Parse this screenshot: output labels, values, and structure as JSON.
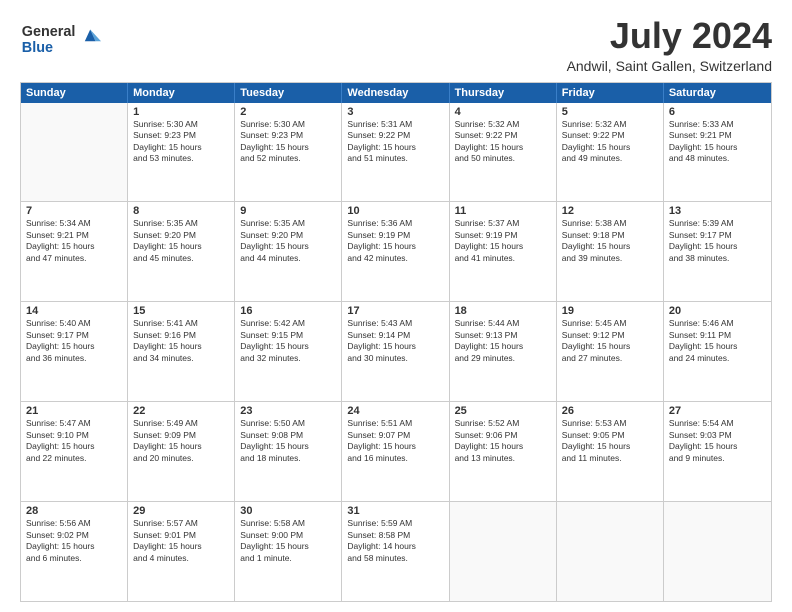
{
  "header": {
    "title": "July 2024",
    "subtitle": "Andwil, Saint Gallen, Switzerland",
    "logo_general": "General",
    "logo_blue": "Blue"
  },
  "calendar": {
    "days": [
      "Sunday",
      "Monday",
      "Tuesday",
      "Wednesday",
      "Thursday",
      "Friday",
      "Saturday"
    ],
    "rows": [
      [
        {
          "day": "",
          "empty": true,
          "lines": []
        },
        {
          "day": "1",
          "empty": false,
          "lines": [
            "Sunrise: 5:30 AM",
            "Sunset: 9:23 PM",
            "Daylight: 15 hours",
            "and 53 minutes."
          ]
        },
        {
          "day": "2",
          "empty": false,
          "lines": [
            "Sunrise: 5:30 AM",
            "Sunset: 9:23 PM",
            "Daylight: 15 hours",
            "and 52 minutes."
          ]
        },
        {
          "day": "3",
          "empty": false,
          "lines": [
            "Sunrise: 5:31 AM",
            "Sunset: 9:22 PM",
            "Daylight: 15 hours",
            "and 51 minutes."
          ]
        },
        {
          "day": "4",
          "empty": false,
          "lines": [
            "Sunrise: 5:32 AM",
            "Sunset: 9:22 PM",
            "Daylight: 15 hours",
            "and 50 minutes."
          ]
        },
        {
          "day": "5",
          "empty": false,
          "lines": [
            "Sunrise: 5:32 AM",
            "Sunset: 9:22 PM",
            "Daylight: 15 hours",
            "and 49 minutes."
          ]
        },
        {
          "day": "6",
          "empty": false,
          "lines": [
            "Sunrise: 5:33 AM",
            "Sunset: 9:21 PM",
            "Daylight: 15 hours",
            "and 48 minutes."
          ]
        }
      ],
      [
        {
          "day": "7",
          "empty": false,
          "lines": [
            "Sunrise: 5:34 AM",
            "Sunset: 9:21 PM",
            "Daylight: 15 hours",
            "and 47 minutes."
          ]
        },
        {
          "day": "8",
          "empty": false,
          "lines": [
            "Sunrise: 5:35 AM",
            "Sunset: 9:20 PM",
            "Daylight: 15 hours",
            "and 45 minutes."
          ]
        },
        {
          "day": "9",
          "empty": false,
          "lines": [
            "Sunrise: 5:35 AM",
            "Sunset: 9:20 PM",
            "Daylight: 15 hours",
            "and 44 minutes."
          ]
        },
        {
          "day": "10",
          "empty": false,
          "lines": [
            "Sunrise: 5:36 AM",
            "Sunset: 9:19 PM",
            "Daylight: 15 hours",
            "and 42 minutes."
          ]
        },
        {
          "day": "11",
          "empty": false,
          "lines": [
            "Sunrise: 5:37 AM",
            "Sunset: 9:19 PM",
            "Daylight: 15 hours",
            "and 41 minutes."
          ]
        },
        {
          "day": "12",
          "empty": false,
          "lines": [
            "Sunrise: 5:38 AM",
            "Sunset: 9:18 PM",
            "Daylight: 15 hours",
            "and 39 minutes."
          ]
        },
        {
          "day": "13",
          "empty": false,
          "lines": [
            "Sunrise: 5:39 AM",
            "Sunset: 9:17 PM",
            "Daylight: 15 hours",
            "and 38 minutes."
          ]
        }
      ],
      [
        {
          "day": "14",
          "empty": false,
          "lines": [
            "Sunrise: 5:40 AM",
            "Sunset: 9:17 PM",
            "Daylight: 15 hours",
            "and 36 minutes."
          ]
        },
        {
          "day": "15",
          "empty": false,
          "lines": [
            "Sunrise: 5:41 AM",
            "Sunset: 9:16 PM",
            "Daylight: 15 hours",
            "and 34 minutes."
          ]
        },
        {
          "day": "16",
          "empty": false,
          "lines": [
            "Sunrise: 5:42 AM",
            "Sunset: 9:15 PM",
            "Daylight: 15 hours",
            "and 32 minutes."
          ]
        },
        {
          "day": "17",
          "empty": false,
          "lines": [
            "Sunrise: 5:43 AM",
            "Sunset: 9:14 PM",
            "Daylight: 15 hours",
            "and 30 minutes."
          ]
        },
        {
          "day": "18",
          "empty": false,
          "lines": [
            "Sunrise: 5:44 AM",
            "Sunset: 9:13 PM",
            "Daylight: 15 hours",
            "and 29 minutes."
          ]
        },
        {
          "day": "19",
          "empty": false,
          "lines": [
            "Sunrise: 5:45 AM",
            "Sunset: 9:12 PM",
            "Daylight: 15 hours",
            "and 27 minutes."
          ]
        },
        {
          "day": "20",
          "empty": false,
          "lines": [
            "Sunrise: 5:46 AM",
            "Sunset: 9:11 PM",
            "Daylight: 15 hours",
            "and 24 minutes."
          ]
        }
      ],
      [
        {
          "day": "21",
          "empty": false,
          "lines": [
            "Sunrise: 5:47 AM",
            "Sunset: 9:10 PM",
            "Daylight: 15 hours",
            "and 22 minutes."
          ]
        },
        {
          "day": "22",
          "empty": false,
          "lines": [
            "Sunrise: 5:49 AM",
            "Sunset: 9:09 PM",
            "Daylight: 15 hours",
            "and 20 minutes."
          ]
        },
        {
          "day": "23",
          "empty": false,
          "lines": [
            "Sunrise: 5:50 AM",
            "Sunset: 9:08 PM",
            "Daylight: 15 hours",
            "and 18 minutes."
          ]
        },
        {
          "day": "24",
          "empty": false,
          "lines": [
            "Sunrise: 5:51 AM",
            "Sunset: 9:07 PM",
            "Daylight: 15 hours",
            "and 16 minutes."
          ]
        },
        {
          "day": "25",
          "empty": false,
          "lines": [
            "Sunrise: 5:52 AM",
            "Sunset: 9:06 PM",
            "Daylight: 15 hours",
            "and 13 minutes."
          ]
        },
        {
          "day": "26",
          "empty": false,
          "lines": [
            "Sunrise: 5:53 AM",
            "Sunset: 9:05 PM",
            "Daylight: 15 hours",
            "and 11 minutes."
          ]
        },
        {
          "day": "27",
          "empty": false,
          "lines": [
            "Sunrise: 5:54 AM",
            "Sunset: 9:03 PM",
            "Daylight: 15 hours",
            "and 9 minutes."
          ]
        }
      ],
      [
        {
          "day": "28",
          "empty": false,
          "lines": [
            "Sunrise: 5:56 AM",
            "Sunset: 9:02 PM",
            "Daylight: 15 hours",
            "and 6 minutes."
          ]
        },
        {
          "day": "29",
          "empty": false,
          "lines": [
            "Sunrise: 5:57 AM",
            "Sunset: 9:01 PM",
            "Daylight: 15 hours",
            "and 4 minutes."
          ]
        },
        {
          "day": "30",
          "empty": false,
          "lines": [
            "Sunrise: 5:58 AM",
            "Sunset: 9:00 PM",
            "Daylight: 15 hours",
            "and 1 minute."
          ]
        },
        {
          "day": "31",
          "empty": false,
          "lines": [
            "Sunrise: 5:59 AM",
            "Sunset: 8:58 PM",
            "Daylight: 14 hours",
            "and 58 minutes."
          ]
        },
        {
          "day": "",
          "empty": true,
          "lines": []
        },
        {
          "day": "",
          "empty": true,
          "lines": []
        },
        {
          "day": "",
          "empty": true,
          "lines": []
        }
      ]
    ]
  }
}
